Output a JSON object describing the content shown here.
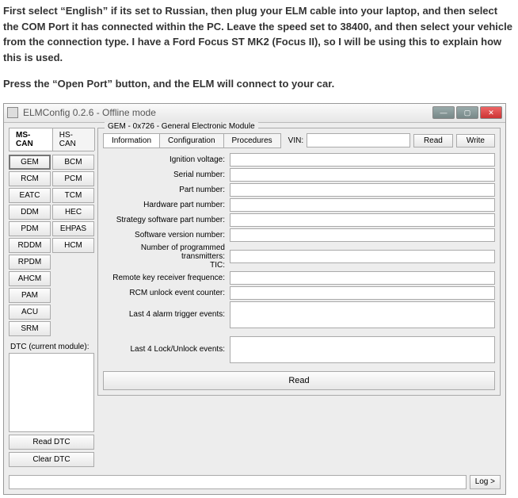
{
  "intro": {
    "p1": "First select “English” if its set to Russian, then plug your ELM cable into your laptop, and then select the COM Port it has connected within the PC. Leave the speed set to 38400, and then select your vehicle from the connection type. I have a Ford Focus ST MK2 (Focus II), so I will be using this to explain how this is used.",
    "p2": "Press the “Open Port” button, and the ELM will connect to your car."
  },
  "window": {
    "title": "ELMConfig 0.2.6 - Offline mode"
  },
  "bus_tabs": {
    "t1": "MS-CAN",
    "t2": "HS-CAN"
  },
  "modules": {
    "m0": "GEM",
    "m1": "BCM",
    "m2": "RCM",
    "m3": "PCM",
    "m4": "EATC",
    "m5": "TCM",
    "m6": "DDM",
    "m7": "HEC",
    "m8": "PDM",
    "m9": "EHPAS",
    "m10": "RDDM",
    "m11": "HCM",
    "m12": "RPDM",
    "m13": "AHCM",
    "m14": "PAM",
    "m15": "ACU",
    "m16": "SRM"
  },
  "dtc": {
    "label": "DTC (current module):",
    "read": "Read DTC",
    "clear": "Clear DTC"
  },
  "group": {
    "legend": "GEM - 0x726 - General Electronic Module"
  },
  "subtabs": {
    "t1": "Information",
    "t2": "Configuration",
    "t3": "Procedures"
  },
  "vin": {
    "label": "VIN:",
    "read": "Read",
    "write": "Write"
  },
  "fields": {
    "f0": "Ignition voltage:",
    "f1": "Serial number:",
    "f2": "Part number:",
    "f3": "Hardware part number:",
    "f4": "Strategy software part number:",
    "f5": "Software version number:",
    "f6": "Number of programmed transmitters:",
    "f6b": "TIC:",
    "f7": "Remote key receiver frequence:",
    "f8": "RCM unlock event counter:",
    "f9": "Last 4 alarm trigger events:",
    "f10": "Last 4 Lock/Unlock events:"
  },
  "buttons": {
    "read": "Read",
    "log": "Log >"
  }
}
